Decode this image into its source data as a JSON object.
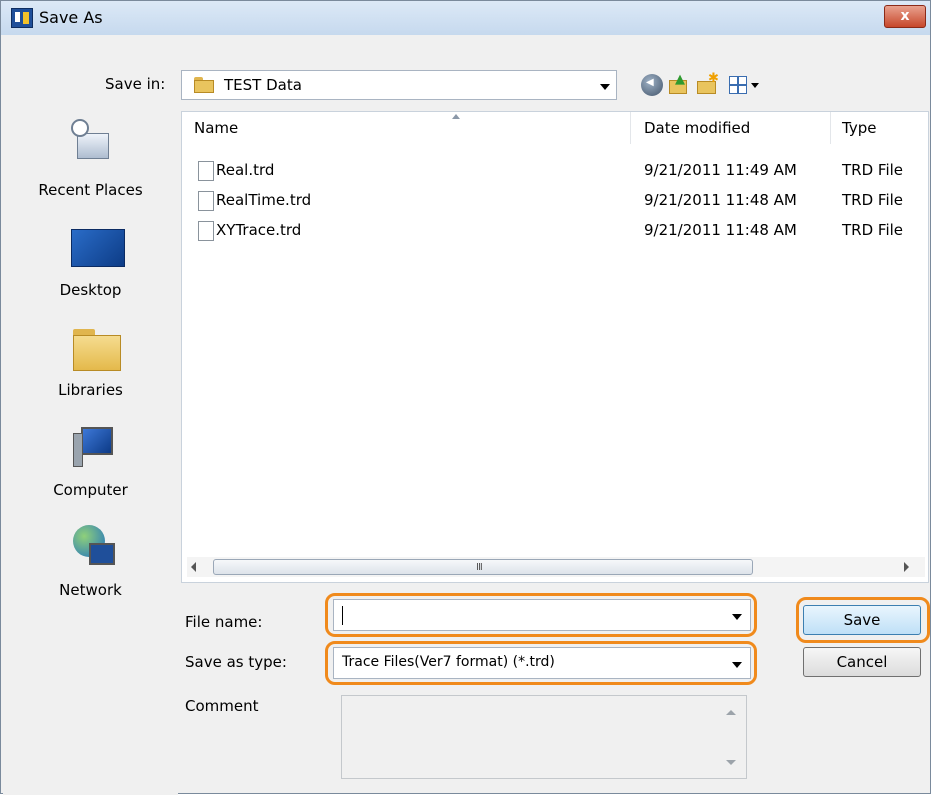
{
  "window": {
    "title": "Save As",
    "close_label": "x"
  },
  "save_in": {
    "label": "Save in:",
    "value": "TEST Data"
  },
  "toolbar_icons": [
    "back-icon",
    "up-folder-icon",
    "new-folder-icon",
    "view-menu-icon"
  ],
  "places": [
    {
      "label": "Recent Places",
      "icon": "recent-places-icon"
    },
    {
      "label": "Desktop",
      "icon": "desktop-icon"
    },
    {
      "label": "Libraries",
      "icon": "libraries-icon"
    },
    {
      "label": "Computer",
      "icon": "computer-icon"
    },
    {
      "label": "Network",
      "icon": "network-icon"
    }
  ],
  "columns": {
    "name": "Name",
    "date": "Date modified",
    "type": "Type"
  },
  "files": [
    {
      "name": "Real.trd",
      "date": "9/21/2011 11:49 AM",
      "type": "TRD File"
    },
    {
      "name": "RealTime.trd",
      "date": "9/21/2011 11:48 AM",
      "type": "TRD File"
    },
    {
      "name": "XYTrace.trd",
      "date": "9/21/2011 11:48 AM",
      "type": "TRD File"
    }
  ],
  "scrollbar": {
    "grip": "III"
  },
  "form": {
    "file_name_label": "File name:",
    "file_name_value": "",
    "save_type_label": "Save as type:",
    "save_type_value": "Trace Files(Ver7 format) (*.trd)",
    "comment_label": "Comment",
    "comment_value": ""
  },
  "buttons": {
    "save": "Save",
    "cancel": "Cancel"
  },
  "colors": {
    "highlight": "#f08a1c",
    "title_bar": "#dce9f7",
    "close_button": "#c7472b"
  }
}
